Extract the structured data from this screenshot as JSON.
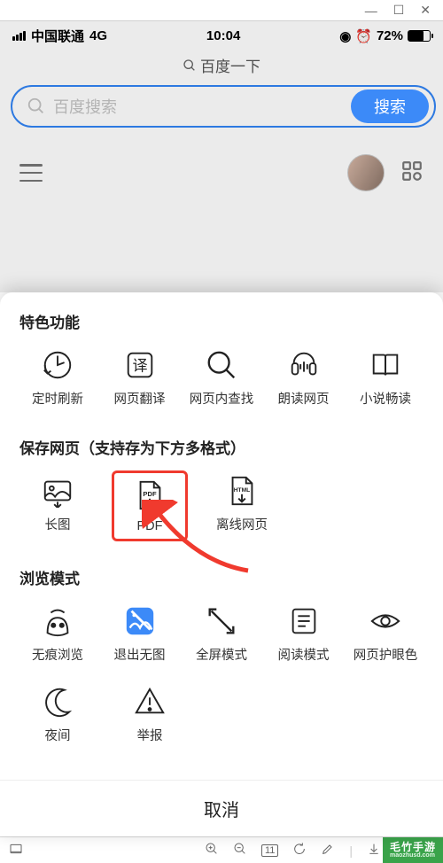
{
  "status": {
    "carrier": "中国联通",
    "network": "4G",
    "time": "10:04",
    "battery_pct": "72%"
  },
  "header": {
    "title": "百度一下",
    "search_placeholder": "百度搜索",
    "search_button": "搜索"
  },
  "sheet": {
    "section_features_title": "特色功能",
    "features": [
      {
        "name": "timer-refresh-icon",
        "label": "定时刷新"
      },
      {
        "name": "translate-icon",
        "label": "网页翻译",
        "glyph": "译"
      },
      {
        "name": "find-in-page-icon",
        "label": "网页内查找"
      },
      {
        "name": "read-aloud-icon",
        "label": "朗读网页"
      },
      {
        "name": "novel-mode-icon",
        "label": "小说畅读"
      }
    ],
    "section_save_title": "保存网页（支持存为下方多格式）",
    "save": [
      {
        "name": "long-image-icon",
        "label": "长图"
      },
      {
        "name": "pdf-icon",
        "label": "PDF",
        "glyph": "PDF",
        "highlight": true
      },
      {
        "name": "offline-page-icon",
        "label": "离线网页",
        "glyph": "HTML"
      }
    ],
    "section_browse_title": "浏览模式",
    "browse_row1": [
      {
        "name": "incognito-icon",
        "label": "无痕浏览"
      },
      {
        "name": "exit-noimage-icon",
        "label": "退出无图",
        "active": true
      },
      {
        "name": "fullscreen-icon",
        "label": "全屏模式"
      },
      {
        "name": "reader-mode-icon",
        "label": "阅读模式"
      },
      {
        "name": "eye-protect-icon",
        "label": "网页护眼色"
      }
    ],
    "browse_row2": [
      {
        "name": "night-mode-icon",
        "label": "夜间"
      },
      {
        "name": "report-icon",
        "label": "举报"
      }
    ],
    "cancel": "取消"
  },
  "os_bar": {
    "tab_count": "11"
  },
  "watermark": {
    "brand": "毛竹手游",
    "url": "maozhusd.com"
  }
}
